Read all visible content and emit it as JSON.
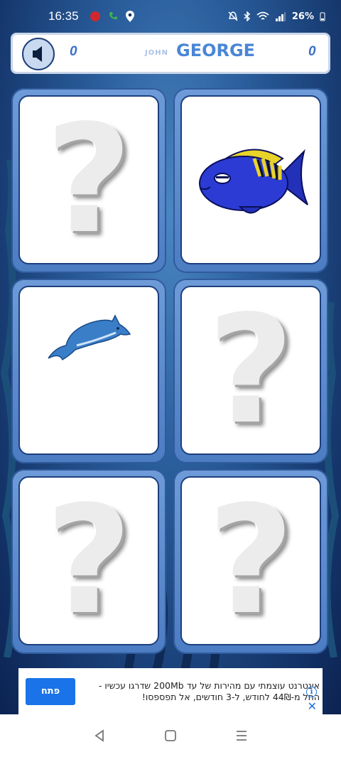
{
  "status_bar": {
    "time": "16:35",
    "battery": "26%",
    "icons": [
      "notification-badge-icon",
      "call-icon",
      "location-icon",
      "mute-icon",
      "bluetooth-icon",
      "wifi-icon",
      "signal-icon"
    ]
  },
  "scoreboard": {
    "left_score": "0",
    "player_small": "JOHN",
    "player_big": "GEORGE",
    "right_score": "0",
    "sound_icon": "speaker-icon"
  },
  "cards": [
    {
      "state": "hidden",
      "symbol": "?"
    },
    {
      "state": "revealed",
      "content": "yellow-striped-blue-fish"
    },
    {
      "state": "revealed",
      "content": "dolphin"
    },
    {
      "state": "hidden",
      "symbol": "?"
    },
    {
      "state": "hidden",
      "symbol": "?"
    },
    {
      "state": "hidden",
      "symbol": "?"
    }
  ],
  "ad": {
    "button_label": "פתח",
    "text": "אינטרנט עוצמתי עם מהירות של עד 200Mb שדרגו עכשיו - החל מ-44₪ לחודש, ל-3 חודשים, אל תפספסו!"
  },
  "colors": {
    "card_frame": "#5a88c8",
    "card_border": "#1c3f7e",
    "score_text": "#3a6fc4",
    "player_big": "#4a86d6",
    "ad_button": "#1a73e8"
  },
  "nav": [
    "back-icon",
    "home-icon",
    "recents-icon"
  ]
}
